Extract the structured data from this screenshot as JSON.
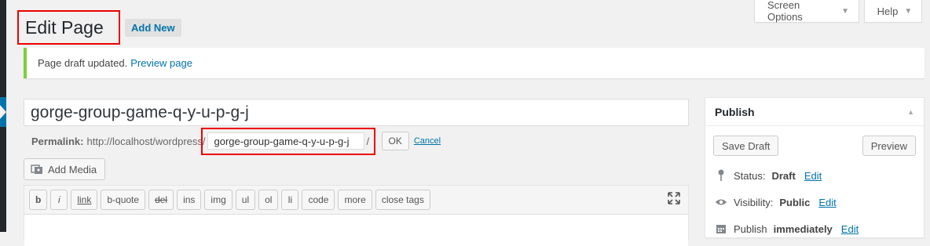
{
  "screen_meta": {
    "screen_options": "Screen Options",
    "help": "Help"
  },
  "header": {
    "title": "Edit Page",
    "add_new": "Add New"
  },
  "notice": {
    "text": "Page draft updated.",
    "link": "Preview page"
  },
  "editor": {
    "title_value": "gorge-group-game-q-y-u-p-g-j",
    "permalink_label": "Permalink:",
    "permalink_base": "http://localhost/wordpress/",
    "slug_value": "gorge-group-game-q-y-u-p-g-j",
    "ok_label": "OK",
    "cancel_label": "Cancel",
    "add_media_label": "Add Media",
    "quicktags": [
      "b",
      "i",
      "link",
      "b-quote",
      "del",
      "ins",
      "img",
      "ul",
      "ol",
      "li",
      "code",
      "more",
      "close tags"
    ]
  },
  "publish": {
    "title": "Publish",
    "save_draft": "Save Draft",
    "preview": "Preview",
    "status_label": "Status:",
    "status_value": "Draft",
    "visibility_label": "Visibility:",
    "visibility_value": "Public",
    "publish_label": "Publish",
    "publish_value": "immediately",
    "edit": "Edit"
  },
  "colors": {
    "accent": "#0073aa",
    "notice_border": "#7ad03a",
    "highlight": "#ee0000"
  }
}
